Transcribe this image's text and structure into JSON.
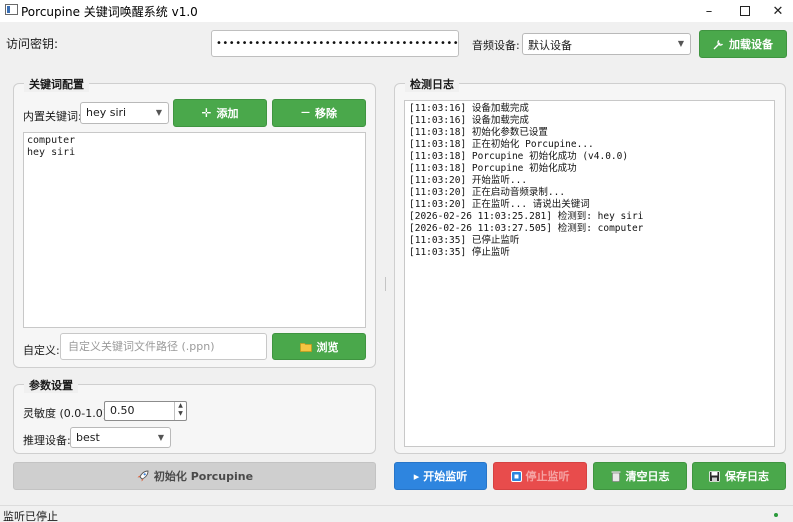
{
  "window": {
    "title": "Porcupine 关键词唤醒系统 v1.0",
    "minimize_glyph": "–",
    "close_glyph": "✕"
  },
  "top": {
    "access_key_label": "访问密钥:",
    "access_key_value": "•••••••••••••••••••••••••••••••••••••••",
    "audio_device_label": "音频设备:",
    "audio_device_value": "默认设备",
    "load_device_button": "加载设备",
    "load_device_icon": "wrench-icon"
  },
  "keyword_config": {
    "title": "关键词配置",
    "builtin_label": "内置关键词:",
    "builtin_value": "hey siri",
    "add_button": "添加",
    "add_icon_glyph": "✛",
    "remove_button": "移除",
    "remove_icon_glyph": "—",
    "keywords": [
      "computer",
      "hey siri"
    ],
    "custom_label": "自定义:",
    "custom_placeholder": "自定义关键词文件路径 (.ppn)",
    "browse_button": "浏览",
    "browse_icon": "folder-icon"
  },
  "params": {
    "title": "参数设置",
    "sensitivity_label": "灵敏度 (0.0-1.0):",
    "sensitivity_value": "0.50",
    "device_label": "推理设备:",
    "device_value": "best"
  },
  "log": {
    "title": "检测日志",
    "lines": [
      "[11:03:16] 设备加载完成",
      "[11:03:16] 设备加载完成",
      "[11:03:18] 初始化参数已设置",
      "[11:03:18] 正在初始化 Porcupine...",
      "[11:03:18] Porcupine 初始化成功 (v4.0.0)",
      "[11:03:18] Porcupine 初始化成功",
      "[11:03:20] 开始监听...",
      "[11:03:20] 正在启动音频录制...",
      "[11:03:20] 正在监听... 请说出关键词",
      "[2026-02-26 11:03:25.281] 检测到: hey siri",
      "[2026-02-26 11:03:27.505] 检测到: computer",
      "[11:03:35] 已停止监听",
      "[11:03:35] 停止监听"
    ]
  },
  "actions": {
    "init_button": "初始化 Porcupine",
    "init_icon": "rocket-icon",
    "start_button": "开始监听",
    "start_glyph": "▸",
    "stop_button": "停止监听",
    "clear_button": "清空日志",
    "save_button": "保存日志"
  },
  "status": {
    "text": "监听已停止"
  },
  "colors": {
    "green": "#4aa84b",
    "blue": "#2e85df",
    "red": "#e84c4c",
    "disabled": "#cfcfcf"
  }
}
